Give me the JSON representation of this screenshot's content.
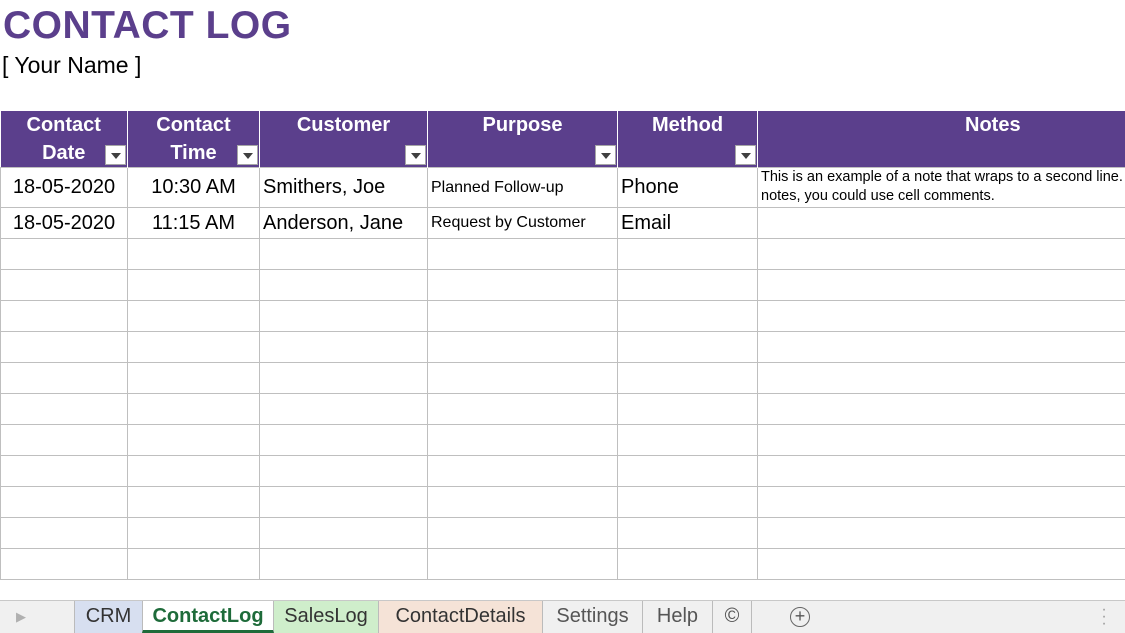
{
  "title": "CONTACT LOG",
  "subtitle": "[ Your Name ]",
  "table": {
    "headers": [
      {
        "line1": "Contact",
        "line2": "Date"
      },
      {
        "line1": "Contact",
        "line2": "Time"
      },
      {
        "line1": "Customer",
        "line2": ""
      },
      {
        "line1": "Purpose",
        "line2": ""
      },
      {
        "line1": "Method",
        "line2": ""
      },
      {
        "line1": "Notes",
        "line2": ""
      }
    ],
    "rows": [
      {
        "date": "18-05-2020",
        "time": "10:30 AM",
        "customer": "Smithers, Joe",
        "purpose": "Planned Follow-up",
        "method": "Phone",
        "notes": "This is an example of a note that wraps to a second line. For long notes, you could use cell comments."
      },
      {
        "date": "18-05-2020",
        "time": "11:15 AM",
        "customer": "Anderson, Jane",
        "purpose": "Request by Customer",
        "method": "Email",
        "notes": ""
      }
    ]
  },
  "tabs": {
    "crm": "CRM",
    "contactlog": "ContactLog",
    "saleslog": "SalesLog",
    "contactdetails": "ContactDetails",
    "settings": "Settings",
    "help": "Help",
    "copyright": "©",
    "active": "ContactLog"
  },
  "icons": {
    "nav": "scroll-left-icon",
    "add": "add-sheet-icon",
    "more": "more-options-icon"
  },
  "colors": {
    "accent": "#5b3f8c",
    "active_tab": "#1e6b3a"
  }
}
